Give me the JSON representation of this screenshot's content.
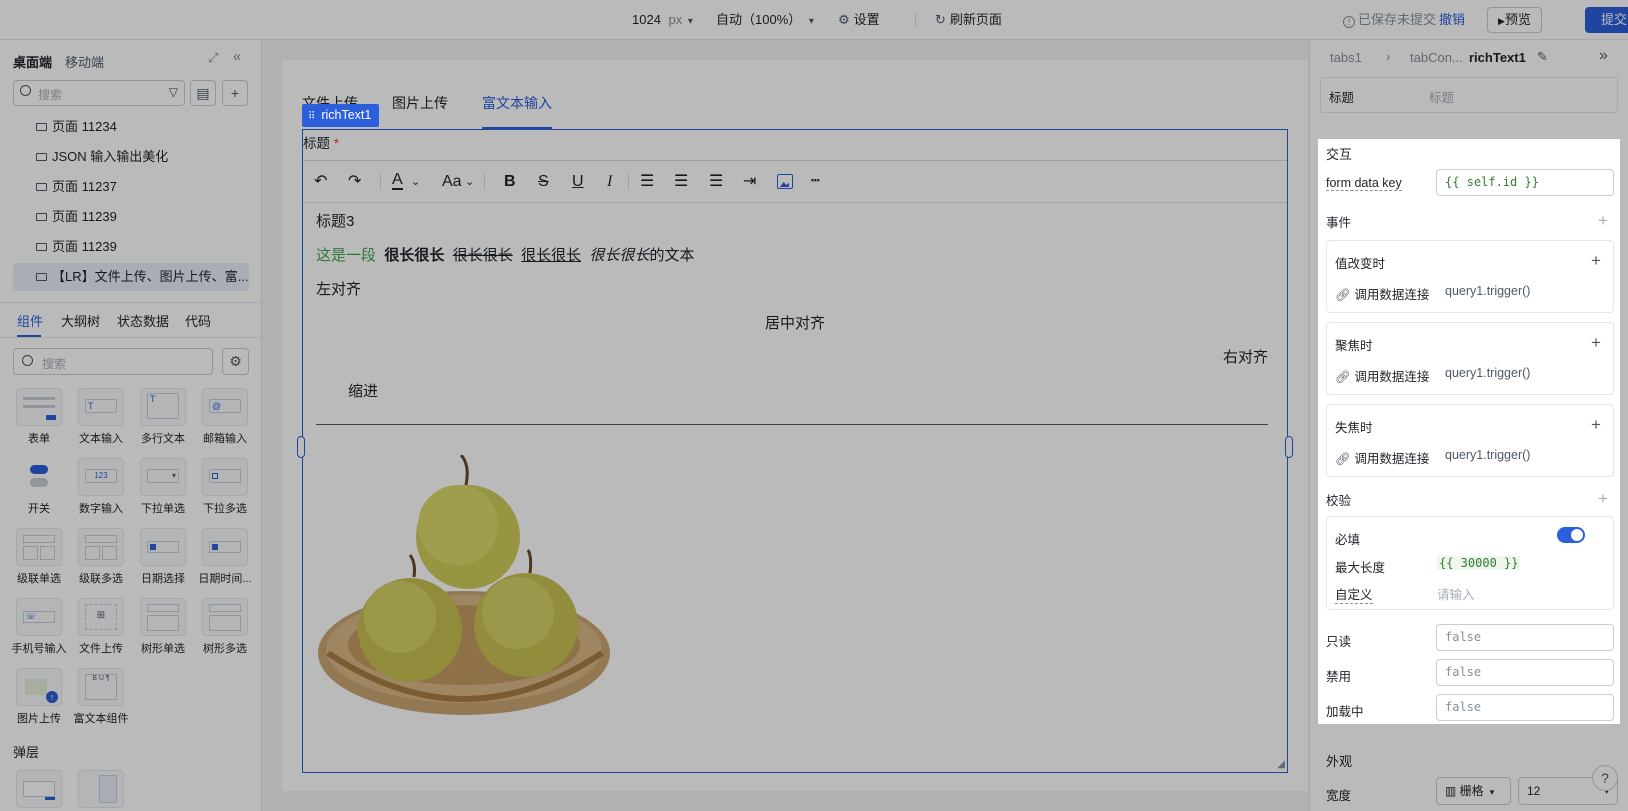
{
  "topbar": {
    "width_value": "1024",
    "width_unit": "px",
    "zoom": "自动（100%）",
    "settings": "设置",
    "refresh": "刷新页面",
    "save_status": "已保存未提交",
    "undo": "撤销",
    "preview": "预览",
    "submit": "提交"
  },
  "left": {
    "tabs": [
      "桌面端",
      "移动端"
    ],
    "search_placeholder": "搜索",
    "pages": [
      "页面 11234",
      "JSON 输入输出美化",
      "页面 11237",
      "页面 11239",
      "页面 11239",
      "【LR】文件上传、图片上传、富..."
    ],
    "panel_tabs": [
      "组件",
      "大纲树",
      "状态数据",
      "代码"
    ],
    "comp_search_placeholder": "搜索",
    "components": [
      "表单",
      "文本输入",
      "多行文本",
      "邮箱输入",
      "开关",
      "数字输入",
      "下拉单选",
      "下拉多选",
      "级联单选",
      "级联多选",
      "日期选择",
      "日期时间...",
      "手机号输入",
      "文件上传",
      "树形单选",
      "树形多选",
      "图片上传",
      "富文本组件"
    ],
    "layer_section": "弹层"
  },
  "canvas": {
    "tabs": [
      "文件上传",
      "图片上传",
      "富文本输入"
    ],
    "selected_badge": "richText1",
    "field_label": "标题",
    "required_mark": "*",
    "content": {
      "heading": "标题3",
      "line_green": "这是一段",
      "line_bold": "很长很长",
      "line_strike": "很长很长",
      "line_underline": "很长很长",
      "line_italic": "很长很长",
      "line_tail": "的文本",
      "left": "左对齐",
      "center": "居中对齐",
      "right": "右对齐",
      "indent": "缩进"
    }
  },
  "right": {
    "breadcrumb": [
      "tabs1",
      "tabCon...",
      "richText1"
    ],
    "title_label": "标题",
    "title_placeholder": "标题",
    "section_interaction": "交互",
    "form_data_key_label": "form data key",
    "form_data_key_value": "{{ self.id }}",
    "events_label": "事件",
    "events": [
      {
        "name": "值改变时",
        "action": "调用数据连接",
        "target": "query1.trigger()"
      },
      {
        "name": "聚焦时",
        "action": "调用数据连接",
        "target": "query1.trigger()"
      },
      {
        "name": "失焦时",
        "action": "调用数据连接",
        "target": "query1.trigger()"
      }
    ],
    "validation_label": "校验",
    "required_label": "必填",
    "required_on": true,
    "max_length_label": "最大长度",
    "max_length_value": "{{ 30000 }}",
    "custom_label": "自定义",
    "custom_placeholder": "请输入",
    "readonly_label": "只读",
    "readonly_value": "false",
    "disabled_label": "禁用",
    "disabled_value": "false",
    "loading_label": "加载中",
    "loading_value": "false",
    "appearance_label": "外观",
    "width_label": "宽度",
    "width_mode": "栅格",
    "width_value": "12"
  },
  "colors": {
    "accent": "#2b5fdc",
    "green": "#3fa74a",
    "code_green": "#2e7d32"
  }
}
